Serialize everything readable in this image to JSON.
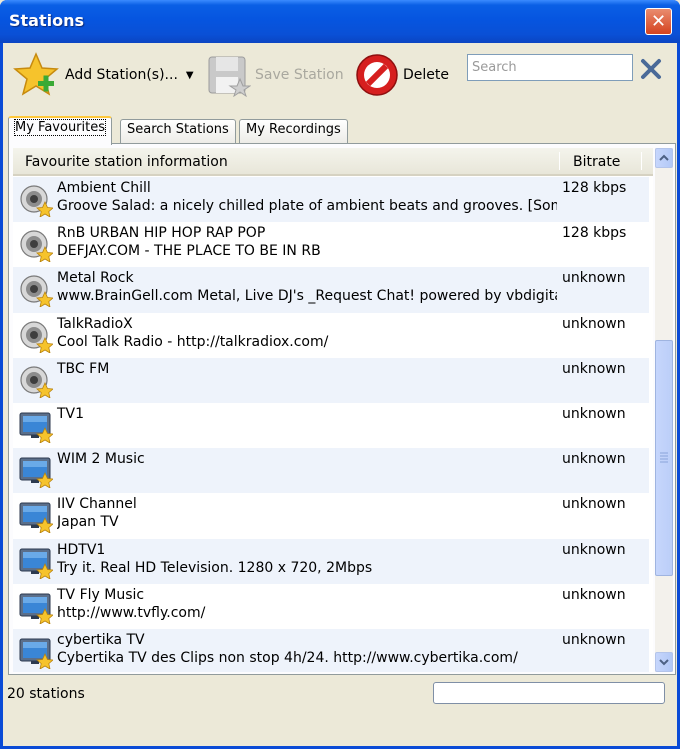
{
  "window": {
    "title": "Stations"
  },
  "toolbar": {
    "add_label": "Add Station(s)...",
    "save_label": "Save Station",
    "delete_label": "Delete",
    "search_placeholder": "Search"
  },
  "tabs": [
    {
      "label": "My Favourites",
      "active": true
    },
    {
      "label": "Search Stations",
      "active": false
    },
    {
      "label": "My Recordings",
      "active": false
    }
  ],
  "list": {
    "columns": [
      "Favourite station information",
      "Bitrate"
    ],
    "rows": [
      {
        "icon": "speaker-icon",
        "name": "Ambient Chill",
        "desc": "Groove Salad: a nicely chilled plate of ambient beats and grooves. [SomaFM",
        "rate": "128 kbps"
      },
      {
        "icon": "speaker-icon",
        "name": "RnB URBAN HIP HOP RAP POP",
        "desc": "DEFJAY.COM - THE PLACE TO BE IN RB",
        "rate": "128 kbps"
      },
      {
        "icon": "speaker-icon",
        "name": "Metal  Rock",
        "desc": "www.BrainGell.com Metal, Live DJ's _Request Chat! powered by vbdigital....",
        "rate": "unknown"
      },
      {
        "icon": "speaker-icon",
        "name": "TalkRadioX",
        "desc": "Cool Talk Radio - http://talkradiox.com/",
        "rate": "unknown"
      },
      {
        "icon": "speaker-icon",
        "name": "TBC FM",
        "desc": "",
        "rate": "unknown"
      },
      {
        "icon": "tv-icon",
        "name": "TV1",
        "desc": "",
        "rate": "unknown"
      },
      {
        "icon": "tv-icon",
        "name": "WIM 2 Music",
        "desc": "",
        "rate": "unknown"
      },
      {
        "icon": "tv-icon",
        "name": "IIV Channel",
        "desc": "Japan TV",
        "rate": "unknown"
      },
      {
        "icon": "tv-icon",
        "name": "HDTV1",
        "desc": "Try it. Real HD Television. 1280 x 720, 2Mbps",
        "rate": "unknown"
      },
      {
        "icon": "tv-icon",
        "name": "TV Fly Music",
        "desc": "http://www.tvfly.com/",
        "rate": "unknown"
      },
      {
        "icon": "tv-icon",
        "name": "cybertika TV",
        "desc": "Cybertika TV des Clips non stop 4h/24. http://www.cybertika.com/",
        "rate": "unknown"
      }
    ]
  },
  "status": {
    "count_text": "20 stations"
  },
  "colors": {
    "titlebar": "#0A50D6",
    "close": "#D5431F",
    "row_alt": "#EEF3FB",
    "tab_highlight": "#FFC83C"
  }
}
